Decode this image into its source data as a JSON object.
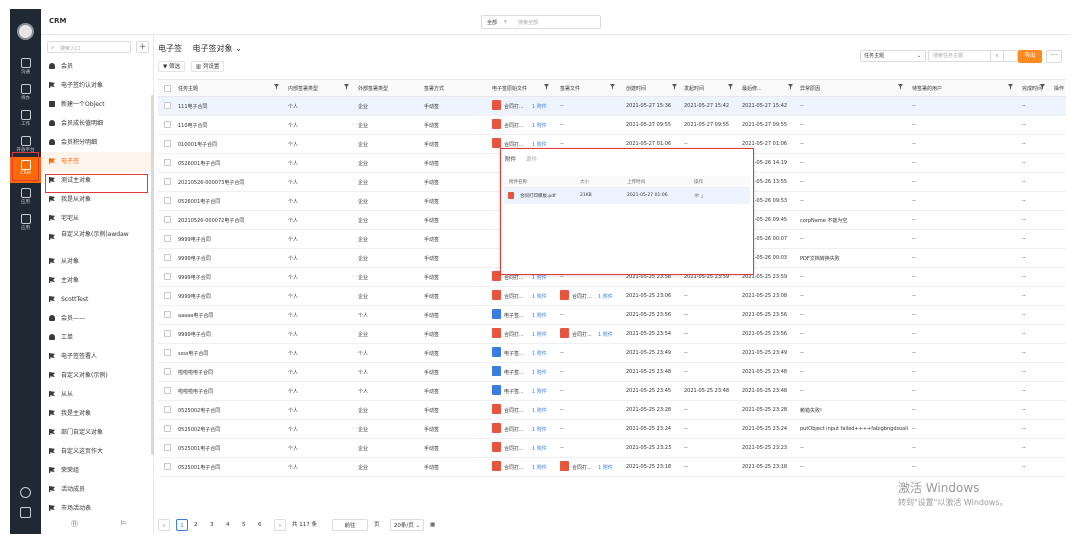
{
  "app": {
    "title": "CRM"
  },
  "global_search": {
    "scope": "全部",
    "placeholder": "搜索全部"
  },
  "rail": {
    "items": [
      {
        "label": "沟通",
        "icon": "chat-icon"
      },
      {
        "label": "待办",
        "icon": "todo-icon"
      },
      {
        "label": "工作",
        "icon": "work-icon"
      },
      {
        "label": "开放平台",
        "icon": "open-platform-icon"
      },
      {
        "label": "CRM",
        "icon": "crm-icon"
      },
      {
        "label": "应用",
        "icon": "apps-icon"
      },
      {
        "label": "应用",
        "icon": "apps-icon"
      }
    ]
  },
  "sidebar": {
    "search_placeholder": "搜索入口",
    "add": "+",
    "items": [
      {
        "label": "会员",
        "icon": "user"
      },
      {
        "label": "电子签约认对象",
        "icon": "flag"
      },
      {
        "label": "新建一个Object",
        "icon": "shield"
      },
      {
        "label": "会员成长值明细",
        "icon": "user"
      },
      {
        "label": "会员积分明细",
        "icon": "user"
      },
      {
        "label": "电子签",
        "icon": "flag",
        "active": true
      },
      {
        "label": "测试主对象",
        "icon": "flag"
      },
      {
        "label": "我是从对象",
        "icon": "flag"
      },
      {
        "label": "宅宅从",
        "icon": "flag"
      },
      {
        "label": "自定义对象(示例)awdaw",
        "icon": "flag",
        "multi": true
      },
      {
        "label": "从对象",
        "icon": "flag"
      },
      {
        "label": "主对象",
        "icon": "flag"
      },
      {
        "label": "ScottTest",
        "icon": "flag"
      },
      {
        "label": "会员——",
        "icon": "user"
      },
      {
        "label": "工单",
        "icon": "user"
      },
      {
        "label": "电子签签署人",
        "icon": "flag"
      },
      {
        "label": "自定义对象(示例)",
        "icon": "flag"
      },
      {
        "label": "从从",
        "icon": "flag"
      },
      {
        "label": "我是主对象",
        "icon": "flag"
      },
      {
        "label": "部门自定义对象",
        "icon": "flag"
      },
      {
        "label": "自定义这页作大",
        "icon": "flag"
      },
      {
        "label": "荣荣组",
        "icon": "flag"
      },
      {
        "label": "活动成员",
        "icon": "flag"
      },
      {
        "label": "市场活动表",
        "icon": "flag"
      }
    ],
    "bottom_left": "⑪",
    "bottom_right": "⊨"
  },
  "main": {
    "breadcrumb_root": "电子签",
    "view_name": "电子签对象 ⌄",
    "filter_btn": "▼ 筛选",
    "cols_btn": "▥ 列设置",
    "field_select": "任务主题",
    "search_placeholder": "搜索任务主题",
    "export_btn": "导出",
    "more_btn": "···"
  },
  "table": {
    "columns": [
      "任务主题",
      "内部签署类型",
      "外部签署类型",
      "签署方式",
      "电子签原始文件",
      "签署文件",
      "创建时间",
      "发起时间",
      "最后修...",
      "异常原因",
      "待签署的用户",
      "完成时间",
      "操作"
    ],
    "rows": [
      {
        "subject": "111电子合同",
        "inner": "个人",
        "outer": "企业",
        "method": "手动签",
        "origFile": "合同打...",
        "origIcon": "pdf",
        "origLink": "1 附件",
        "signFile": "--",
        "signIcon": "",
        "signLink": "",
        "created": "2021-05-27 15:36",
        "start": "2021-05-27 15:42",
        "last": "2021-05-27 15:42",
        "reason": "--",
        "pending": "--",
        "done": "--",
        "sel": true
      },
      {
        "subject": "110电子合同",
        "inner": "个人",
        "outer": "企业",
        "method": "手动签",
        "origFile": "合同打...",
        "origIcon": "pdf",
        "origLink": "1 附件",
        "signFile": "--",
        "signIcon": "",
        "signLink": "",
        "created": "2021-05-27 09:55",
        "start": "2021-05-27 09:55",
        "last": "2021-05-27 09:55",
        "reason": "--",
        "pending": "--",
        "done": "--"
      },
      {
        "subject": "010001电子合同",
        "inner": "个人",
        "outer": "企业",
        "method": "手动签",
        "origFile": "合同打...",
        "origIcon": "pdf",
        "origLink": "1 附件",
        "signFile": "--",
        "signIcon": "",
        "signLink": "",
        "created": "2021-05-27 01:06",
        "start": "--",
        "last": "2021-05-27 01:06",
        "reason": "--",
        "pending": "--",
        "done": "--"
      },
      {
        "subject": "0526001电子合同",
        "inner": "个人",
        "outer": "企业",
        "method": "手动签",
        "origFile": "",
        "origIcon": "",
        "origLink": "",
        "signFile": "",
        "signIcon": "",
        "signLink": "",
        "created": "",
        "start": "",
        "last": "2021-05-26 14:19",
        "reason": "--",
        "pending": "--",
        "done": "--"
      },
      {
        "subject": "20210526-000073电子合同",
        "inner": "个人",
        "outer": "企业",
        "method": "手动签",
        "origFile": "",
        "origIcon": "",
        "origLink": "",
        "signFile": "",
        "signIcon": "",
        "signLink": "",
        "created": "",
        "start": "",
        "last": "2021-05-26 13:55",
        "reason": "--",
        "pending": "--",
        "done": "--"
      },
      {
        "subject": "0526001电子合同",
        "inner": "个人",
        "outer": "企业",
        "method": "手动签",
        "origFile": "",
        "origIcon": "",
        "origLink": "",
        "signFile": "",
        "signIcon": "",
        "signLink": "",
        "created": "",
        "start": "",
        "last": "2021-05-26 09:53",
        "reason": "--",
        "pending": "--",
        "done": "--"
      },
      {
        "subject": "20210526-000072电子合同",
        "inner": "个人",
        "outer": "企业",
        "method": "手动签",
        "origFile": "",
        "origIcon": "",
        "origLink": "",
        "signFile": "",
        "signIcon": "",
        "signLink": "",
        "created": "",
        "start": "",
        "last": "2021-05-26 09:45",
        "reason": "corpName 不能为空",
        "pending": "--",
        "done": "--"
      },
      {
        "subject": "9999电子合同",
        "inner": "个人",
        "outer": "企业",
        "method": "手动签",
        "origFile": "",
        "origIcon": "",
        "origLink": "",
        "signFile": "",
        "signIcon": "",
        "signLink": "",
        "created": "",
        "start": "",
        "last": "2021-05-26 00:07",
        "reason": "--",
        "pending": "--",
        "done": "--"
      },
      {
        "subject": "9999电子合同",
        "inner": "个人",
        "outer": "企业",
        "method": "手动签",
        "origFile": "",
        "origIcon": "",
        "origLink": "",
        "signFile": "",
        "signIcon": "",
        "signLink": "",
        "created": "",
        "start": "",
        "last": "2021-05-26 00:03",
        "reason": "PDF文档转换失败",
        "pending": "--",
        "done": "--"
      },
      {
        "subject": "9999电子合同",
        "inner": "个人",
        "outer": "企业",
        "method": "手动签",
        "origFile": "合同打...",
        "origIcon": "pdf",
        "origLink": "1 附件",
        "signFile": "--",
        "signIcon": "",
        "signLink": "",
        "created": "2021-05-25 23:58",
        "start": "2021-05-25 23:59",
        "last": "2021-05-25 23:59",
        "reason": "--",
        "pending": "--",
        "done": "--"
      },
      {
        "subject": "9999电子合同",
        "inner": "个人",
        "outer": "企业",
        "method": "手动签",
        "origFile": "合同打...",
        "origIcon": "pdf",
        "origLink": "1 附件",
        "signFile": "合同打...",
        "signIcon": "pdf",
        "signLink": "1 附件",
        "created": "2021-05-25 23:06",
        "start": "--",
        "last": "2021-05-25 23:08",
        "reason": "--",
        "pending": "--",
        "done": "--"
      },
      {
        "subject": "aaaaa电子合同",
        "inner": "个人",
        "outer": "个人",
        "method": "手动签",
        "origFile": "电子签...",
        "origIcon": "word",
        "origLink": "1 附件",
        "signFile": "--",
        "signIcon": "",
        "signLink": "",
        "created": "2021-05-25 23:56",
        "start": "--",
        "last": "2021-05-25 23:56",
        "reason": "--",
        "pending": "--",
        "done": "--"
      },
      {
        "subject": "9999电子合同",
        "inner": "个人",
        "outer": "企业",
        "method": "手动签",
        "origFile": "合同打...",
        "origIcon": "pdf",
        "origLink": "1 附件",
        "signFile": "合同打...",
        "signIcon": "pdf",
        "signLink": "1 附件",
        "created": "2021-05-25 23:54",
        "start": "--",
        "last": "2021-05-25 23:56",
        "reason": "--",
        "pending": "--",
        "done": "--"
      },
      {
        "subject": "ssss电子合同",
        "inner": "个人",
        "outer": "个人",
        "method": "手动签",
        "origFile": "电子签...",
        "origIcon": "word",
        "origLink": "1 附件",
        "signFile": "--",
        "signIcon": "",
        "signLink": "",
        "created": "2021-05-25 23:49",
        "start": "--",
        "last": "2021-05-25 23:49",
        "reason": "--",
        "pending": "--",
        "done": "--"
      },
      {
        "subject": "啦啦啦电子合同",
        "inner": "个人",
        "outer": "个人",
        "method": "手动签",
        "origFile": "电子签...",
        "origIcon": "word",
        "origLink": "1 附件",
        "signFile": "--",
        "signIcon": "",
        "signLink": "",
        "created": "2021-05-25 23:48",
        "start": "--",
        "last": "2021-05-25 23:48",
        "reason": "--",
        "pending": "--",
        "done": "--"
      },
      {
        "subject": "啦啦啦电子合同",
        "inner": "个人",
        "outer": "个人",
        "method": "手动签",
        "origFile": "电子签...",
        "origIcon": "word",
        "origLink": "1 附件",
        "signFile": "--",
        "signIcon": "",
        "signLink": "",
        "created": "2021-05-25 23:45",
        "start": "2021-05-25 23:48",
        "last": "2021-05-25 23:48",
        "reason": "--",
        "pending": "--",
        "done": "--"
      },
      {
        "subject": "0525002电子合同",
        "inner": "个人",
        "outer": "企业",
        "method": "手动签",
        "origFile": "合同打...",
        "origIcon": "pdf",
        "origLink": "1 附件",
        "signFile": "--",
        "signIcon": "",
        "signLink": "",
        "created": "2021-05-25 23:28",
        "start": "--",
        "last": "2021-05-25 23:28",
        "reason": "赖错失败!",
        "pending": "--",
        "done": "--"
      },
      {
        "subject": "0525002电子合同",
        "inner": "个人",
        "outer": "企业",
        "method": "手动签",
        "origFile": "合同打...",
        "origIcon": "pdf",
        "origLink": "1 附件",
        "signFile": "--",
        "signIcon": "",
        "signLink": "",
        "created": "2021-05-25 23:24",
        "start": "--",
        "last": "2021-05-25 23:24",
        "reason": "putObject input failed++++fabigbngdsoali...",
        "pending": "--",
        "done": "--"
      },
      {
        "subject": "0525001电子合同",
        "inner": "个人",
        "outer": "企业",
        "method": "手动签",
        "origFile": "合同打...",
        "origIcon": "pdf",
        "origLink": "1 附件",
        "signFile": "--",
        "signIcon": "",
        "signLink": "",
        "created": "2021-05-25 23:23",
        "start": "--",
        "last": "2021-05-25 23:23",
        "reason": "--",
        "pending": "--",
        "done": "--"
      },
      {
        "subject": "0525001电子合同",
        "inner": "个人",
        "outer": "企业",
        "method": "手动签",
        "origFile": "合同打...",
        "origIcon": "pdf",
        "origLink": "1 附件",
        "signFile": "合同打...",
        "signIcon": "pdf",
        "signLink": "1 附件",
        "created": "2021-05-25 23:18",
        "start": "--",
        "last": "2021-05-25 23:18",
        "reason": "--",
        "pending": "--",
        "done": "--"
      }
    ]
  },
  "popover": {
    "tab_active": "附件",
    "tab_inactive": "源件",
    "cols": [
      "附件名称",
      "大小",
      "上传时间",
      "操作"
    ],
    "file": {
      "name": "合同打印模板.pdf",
      "size": "21KB",
      "time": "2021-05-27 01:06",
      "actions": "👁 ⤓"
    }
  },
  "pager": {
    "prev": "‹",
    "pages": [
      "1",
      "2",
      "3",
      "4",
      "5",
      "6"
    ],
    "next": "›",
    "total": "共 117 条",
    "jump_label": "前往",
    "page_unit": "页",
    "size": "20条/页 ⌄",
    "grid": "▦"
  },
  "watermark": {
    "line1": "激活 Windows",
    "line2": "转到\"设置\"以激活 Windows。"
  }
}
